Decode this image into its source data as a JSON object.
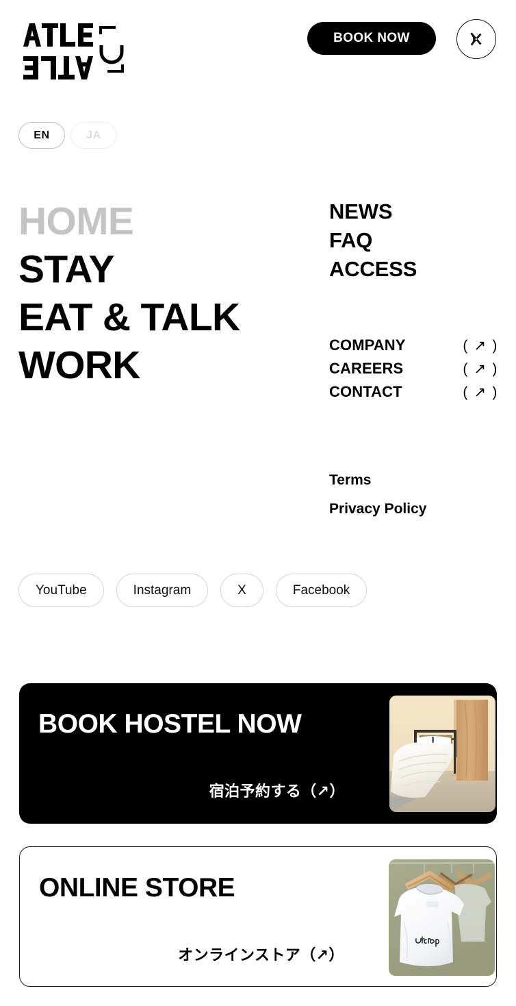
{
  "header": {
    "logo_text_top": "ATLE",
    "logo_text_bottom": "ELTA",
    "logo_mark": "rotated-d-mark",
    "book_now_label": "BOOK NOW",
    "close_label": "close-menu"
  },
  "language": {
    "options": [
      {
        "code": "EN",
        "active": true
      },
      {
        "code": "JA",
        "active": false
      }
    ]
  },
  "nav_primary": [
    {
      "label": "HOME",
      "current": true
    },
    {
      "label": "STAY",
      "current": false
    },
    {
      "label": "EAT & TALK",
      "current": false
    },
    {
      "label": "WORK",
      "current": false
    }
  ],
  "nav_secondary": [
    {
      "label": "NEWS"
    },
    {
      "label": "FAQ"
    },
    {
      "label": "ACCESS"
    }
  ],
  "nav_external": [
    {
      "label": "COMPANY",
      "arrow": "( ↗ )"
    },
    {
      "label": "CAREERS",
      "arrow": "( ↗ )"
    },
    {
      "label": "CONTACT",
      "arrow": "( ↗ )"
    }
  ],
  "nav_legal": [
    {
      "label": "Terms"
    },
    {
      "label": "Privacy Policy"
    }
  ],
  "social": [
    {
      "label": "YouTube"
    },
    {
      "label": "Instagram"
    },
    {
      "label": "X"
    },
    {
      "label": "Facebook"
    }
  ],
  "promos": [
    {
      "title": "BOOK HOSTEL NOW",
      "cta": "宿泊予約する（↗）",
      "image": "hostel-bedroom-photo",
      "theme": "dark"
    },
    {
      "title": "ONLINE STORE",
      "cta": "オンラインストア（↗）",
      "image": "white-tshirts-on-hangers-photo",
      "theme": "light"
    }
  ],
  "colors": {
    "background": "#ffffff",
    "text": "#000000",
    "muted": "#c4c4c4",
    "accent_dark": "#000000",
    "border_light": "#d4d4d4"
  }
}
